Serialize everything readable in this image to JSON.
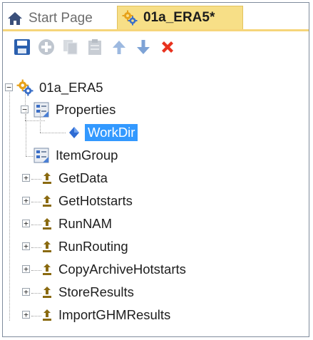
{
  "tabs": [
    {
      "label": "Start Page",
      "icon": "home-icon",
      "active": false
    },
    {
      "label": "01a_ERA5*",
      "icon": "gear-icon",
      "active": true
    }
  ],
  "toolbar": {
    "buttons": [
      {
        "name": "save-button",
        "icon": "save-icon"
      },
      {
        "name": "add-button",
        "icon": "add-icon"
      },
      {
        "name": "copy-button",
        "icon": "copy-icon"
      },
      {
        "name": "paste-button",
        "icon": "paste-icon"
      },
      {
        "name": "move-up-button",
        "icon": "arrow-up-icon"
      },
      {
        "name": "move-down-button",
        "icon": "arrow-down-icon"
      },
      {
        "name": "delete-button",
        "icon": "delete-icon"
      }
    ]
  },
  "tree": {
    "root": {
      "label": "01a_ERA5",
      "icon": "gear-icon",
      "expanded": true
    },
    "properties": {
      "label": "Properties",
      "icon": "properties-icon",
      "expanded": true
    },
    "workdir": {
      "label": "WorkDir",
      "icon": "diamond-icon",
      "selected": true
    },
    "itemgroup": {
      "label": "ItemGroup",
      "icon": "properties-icon"
    },
    "targets": [
      {
        "label": "GetData",
        "icon": "target-icon"
      },
      {
        "label": "GetHotstarts",
        "icon": "target-icon"
      },
      {
        "label": "RunNAM",
        "icon": "target-icon"
      },
      {
        "label": "RunRouting",
        "icon": "target-icon"
      },
      {
        "label": "CopyArchiveHotstarts",
        "icon": "target-icon"
      },
      {
        "label": "StoreResults",
        "icon": "target-icon"
      },
      {
        "label": "ImportGHMResults",
        "icon": "target-icon"
      }
    ]
  },
  "colors": {
    "active_tab": "#f7df87",
    "tab_underline": "#f6d57a",
    "selection": "#3399ff",
    "delete": "#e8321e",
    "arrow": "#7ea3d6",
    "save": "#2a5fae"
  }
}
